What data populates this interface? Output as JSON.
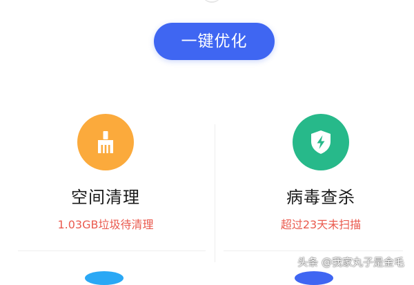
{
  "colors": {
    "accent": "#3f66f2",
    "space_clean_icon_bg": "#fbaa3c",
    "antivirus_icon_bg": "#27b98a",
    "subtitle_red": "#ea5a4e"
  },
  "optimize_button": {
    "label": "一键优化"
  },
  "tiles": [
    {
      "title": "空间清理",
      "subtitle": "1.03GB垃圾待清理",
      "icon": "broom-icon"
    },
    {
      "title": "病毒查杀",
      "subtitle": "超过23天未扫描",
      "icon": "shield-bolt-icon"
    }
  ],
  "watermark": {
    "text": "头条 @我家丸子是金毛"
  }
}
